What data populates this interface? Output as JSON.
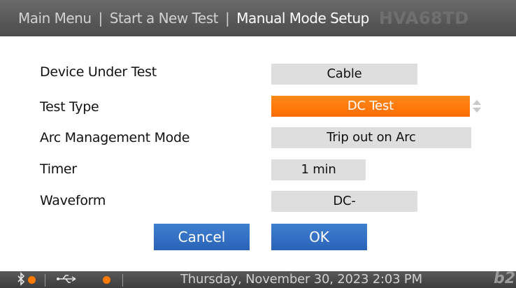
{
  "header": {
    "breadcrumb": [
      "Main Menu",
      "Start a New Test",
      "Manual Mode Setup"
    ],
    "separator": "|",
    "model": "HVA68TD"
  },
  "settings": [
    {
      "label": "Device Under Test",
      "value": "Cable",
      "selected": false
    },
    {
      "label": "Test Type",
      "value": "DC Test",
      "selected": true
    },
    {
      "label": "Arc Management Mode",
      "value": "Trip out on Arc",
      "selected": false
    },
    {
      "label": "Timer",
      "value": "1 min",
      "selected": false
    },
    {
      "label": "Waveform",
      "value": "DC-",
      "selected": false
    }
  ],
  "buttons": {
    "cancel": "Cancel",
    "ok": "OK"
  },
  "footer": {
    "datetime": "Thursday, November 30, 2023 2:03 PM",
    "bluetooth_icon": "bluetooth-icon",
    "usb_icon": "usb-icon",
    "logo": "b2",
    "status_color": "#ff7a00"
  },
  "colors": {
    "selected": "#ff6b00",
    "button": "#2f6cc0",
    "field": "#dedede"
  }
}
